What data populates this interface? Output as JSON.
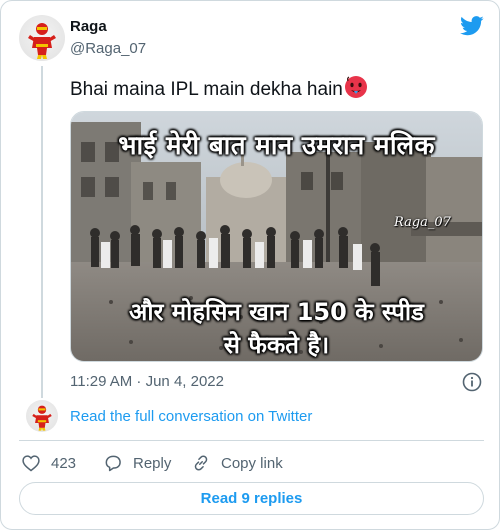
{
  "tweet": {
    "display_name": "Raga",
    "handle": "@Raga_07",
    "text": "Bhai maina IPL main dekha hain",
    "emoji_icon": "hot-face-emoji-icon",
    "timestamp": "11:29 AM · Jun 4, 2022"
  },
  "media": {
    "overlay_top": "भाई मेरी बात मान उमरान मलिक",
    "overlay_line2": "और मोहसिन खान 150 के स्पीड",
    "overlay_line3": "से फैकते है।",
    "watermark": "Raga_07"
  },
  "conversation": {
    "read_label": "Read the full conversation on Twitter"
  },
  "actions": {
    "like_count": "423",
    "reply_label": "Reply",
    "copy_label": "Copy link"
  },
  "footer": {
    "replies_label": "Read 9 replies"
  },
  "colors": {
    "link_blue": "#1d9bf0",
    "muted": "#536471",
    "border": "#cfd9de"
  }
}
